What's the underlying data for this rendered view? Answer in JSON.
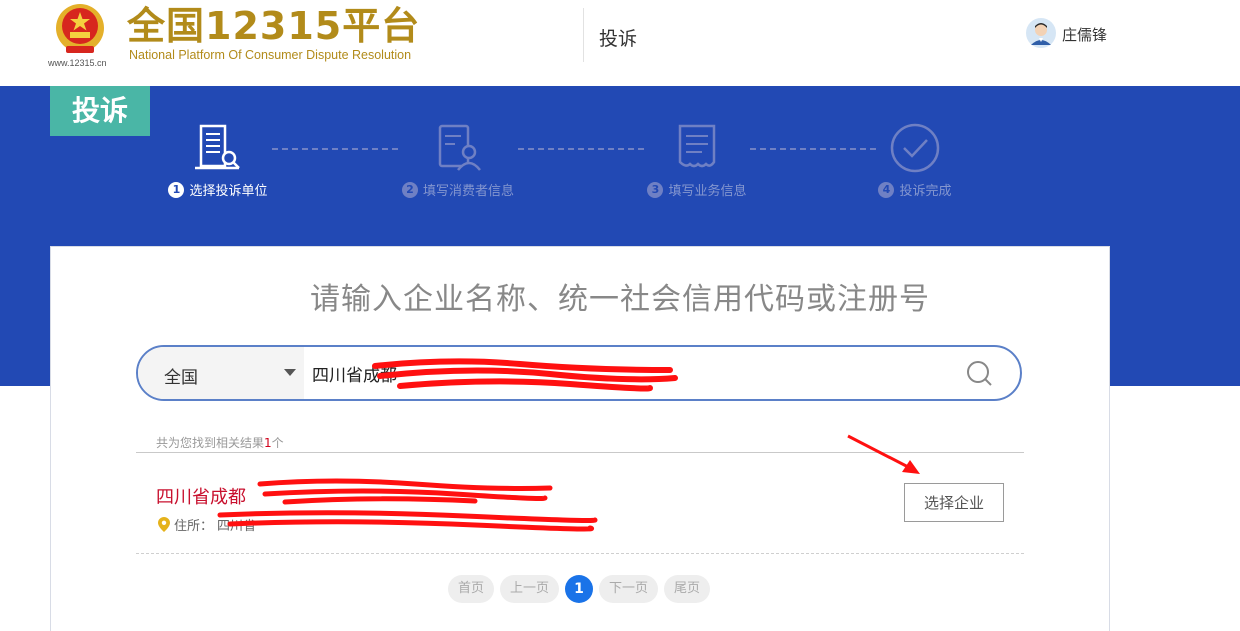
{
  "header": {
    "site_url": "www.12315.cn",
    "logo_title": "全国12315平台",
    "logo_subtitle": "National Platform Of Consumer Dispute Resolution",
    "nav_complaint": "投诉",
    "user_name": "庄儒锋"
  },
  "banner": {
    "tag": "投诉",
    "steps": [
      {
        "num": "1",
        "label": "选择投诉单位",
        "active": true
      },
      {
        "num": "2",
        "label": "填写消费者信息",
        "active": false
      },
      {
        "num": "3",
        "label": "填写业务信息",
        "active": false
      },
      {
        "num": "4",
        "label": "投诉完成",
        "active": false
      }
    ]
  },
  "search": {
    "heading": "请输入企业名称、统一社会信用代码或注册号",
    "region": "全国",
    "query": "四川省成都"
  },
  "results": {
    "count_prefix": "共为您找到相关结果",
    "count": "1",
    "count_suffix": "个",
    "items": [
      {
        "name": "四川省成都",
        "address_label": "住所：",
        "address": "四川省",
        "select_label": "选择企业"
      }
    ]
  },
  "pager": {
    "first": "首页",
    "prev": "上一页",
    "current": "1",
    "next": "下一页",
    "last": "尾页"
  },
  "colors": {
    "banner": "#2249b4",
    "tag": "#4ab6a6",
    "brand_gold": "#b28b1a",
    "result_red": "#c8102e",
    "pager_active": "#1a73e8",
    "redaction": "#ff0000"
  }
}
